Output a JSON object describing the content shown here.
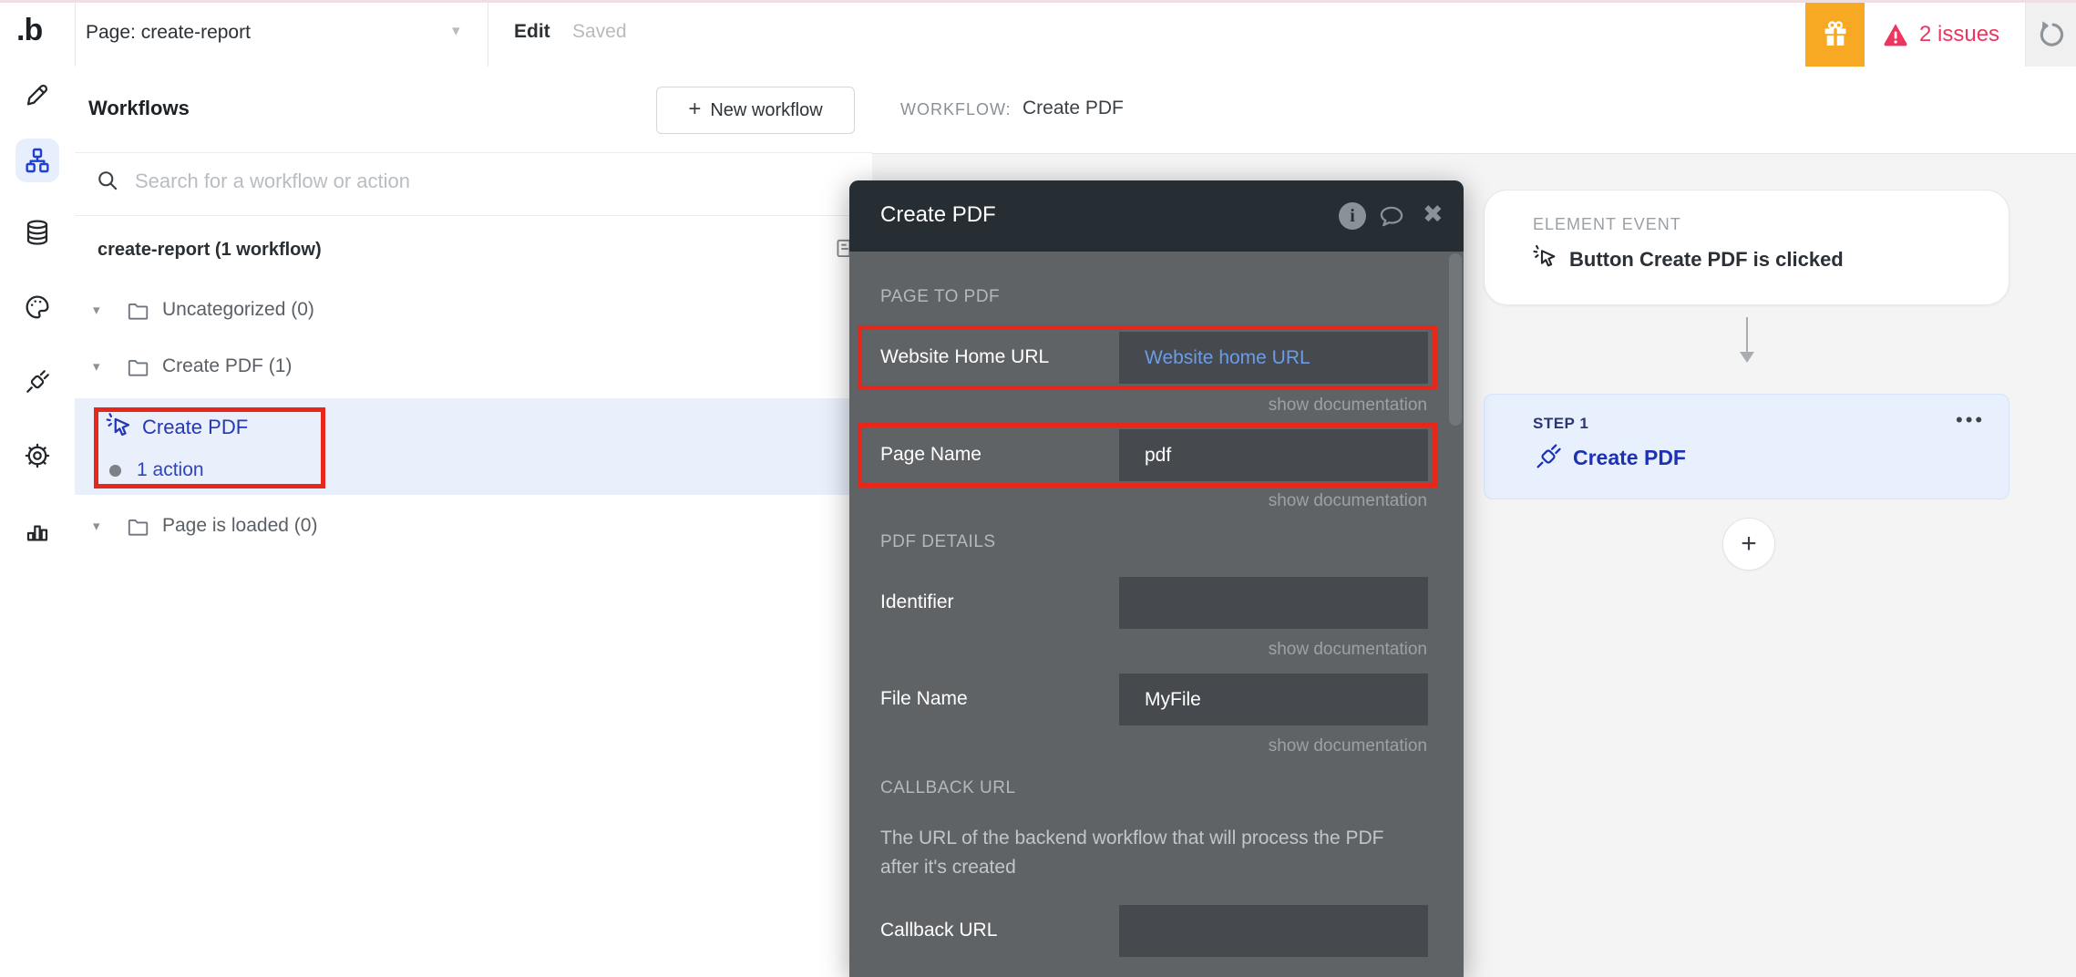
{
  "colors": {
    "annotation_red": "#e8271c",
    "gift_orange": "#f7a923",
    "issue_pink": "#ee3560",
    "accent_blue": "#1d3fd6",
    "link_blue": "#2437b8",
    "modal_header": "#262d33",
    "modal_body": "#5f6366",
    "selection_bg": "#e9f0fb",
    "step_bg": "#e8f0fd"
  },
  "icons": {
    "caret_down": "▾",
    "close": "✖",
    "plus": "+",
    "menu_dots": "•••",
    "bullet": "•"
  },
  "topbar": {
    "logo": ".b",
    "page_selector": "Page: create-report",
    "edit_label": "Edit",
    "saved_label": "Saved",
    "issues_label": "2 issues"
  },
  "sidebar": {
    "icons": [
      "pencil-icon",
      "workflow-icon",
      "database-icon",
      "palette-icon",
      "plug-icon",
      "gear-icon",
      "chart-icon"
    ],
    "active": "workflow-icon"
  },
  "workflows_panel": {
    "title": "Workflows",
    "new_workflow_label": "New workflow",
    "search_placeholder": "Search for a workflow or action",
    "tree_header": "create-report (1 workflow)",
    "folders": [
      {
        "label": "Uncategorized (0)"
      },
      {
        "label": "Create PDF (1)"
      },
      {
        "label": "Page is loaded (0)"
      }
    ],
    "selected_workflow": {
      "title": "Create PDF",
      "subtitle": "1 action"
    }
  },
  "workflow_header": {
    "label": "WORKFLOW:",
    "value": "Create PDF"
  },
  "canvas": {
    "event_card": {
      "kicker": "ELEMENT EVENT",
      "title": "Button Create PDF is clicked"
    },
    "step_card": {
      "kicker": "STEP 1",
      "title": "Create PDF"
    }
  },
  "modal": {
    "title": "Create PDF",
    "section_page_to_pdf": "PAGE TO PDF",
    "section_pdf_details": "PDF DETAILS",
    "section_callback_url": "CALLBACK URL",
    "show_documentation": "show documentation",
    "fields": {
      "website": {
        "label": "Website Home URL",
        "value": "Website home URL"
      },
      "page_name": {
        "label": "Page Name",
        "value": "pdf"
      },
      "identifier": {
        "label": "Identifier",
        "value": ""
      },
      "file_name": {
        "label": "File Name",
        "value": "MyFile"
      },
      "callback": {
        "label": "Callback URL",
        "value": ""
      }
    },
    "callback_description": "The URL of the backend workflow that will process the PDF after it's created"
  }
}
